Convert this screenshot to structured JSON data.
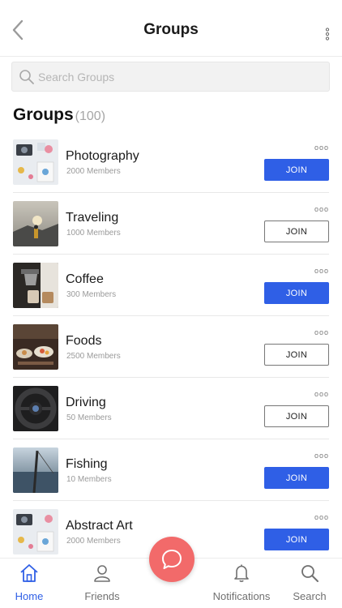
{
  "header": {
    "title": "Groups"
  },
  "search": {
    "placeholder": "Search Groups"
  },
  "section": {
    "title": "Groups",
    "count": "(100)"
  },
  "groups": [
    {
      "name": "Photography",
      "members": "2000 Members",
      "join_label": "JOIN",
      "joined_style": "filled",
      "more": "ooo"
    },
    {
      "name": "Traveling",
      "members": "1000 Members",
      "join_label": "JOIN",
      "joined_style": "outline",
      "more": "ooo"
    },
    {
      "name": "Coffee",
      "members": "300 Members",
      "join_label": "JOIN",
      "joined_style": "filled",
      "more": "ooo"
    },
    {
      "name": "Foods",
      "members": "2500 Members",
      "join_label": "JOIN",
      "joined_style": "outline",
      "more": "ooo"
    },
    {
      "name": "Driving",
      "members": "50 Members",
      "join_label": "JOIN",
      "joined_style": "outline",
      "more": "ooo"
    },
    {
      "name": "Fishing",
      "members": "10 Members",
      "join_label": "JOIN",
      "joined_style": "filled",
      "more": "ooo"
    },
    {
      "name": "Abstract Art",
      "members": "2000 Members",
      "join_label": "JOIN",
      "joined_style": "filled",
      "more": "ooo"
    }
  ],
  "tabs": [
    {
      "label": "Home",
      "icon": "home-icon",
      "active": true
    },
    {
      "label": "Friends",
      "icon": "person-icon",
      "active": false
    },
    {
      "label": "Notifications",
      "icon": "bell-icon",
      "active": false
    },
    {
      "label": "Search",
      "icon": "search-icon",
      "active": false
    }
  ],
  "fab": {
    "icon": "chat-bubble-icon"
  },
  "colors": {
    "accent": "#2f5fe6",
    "fab": "#f26a6a",
    "muted": "#9a9a9a"
  }
}
